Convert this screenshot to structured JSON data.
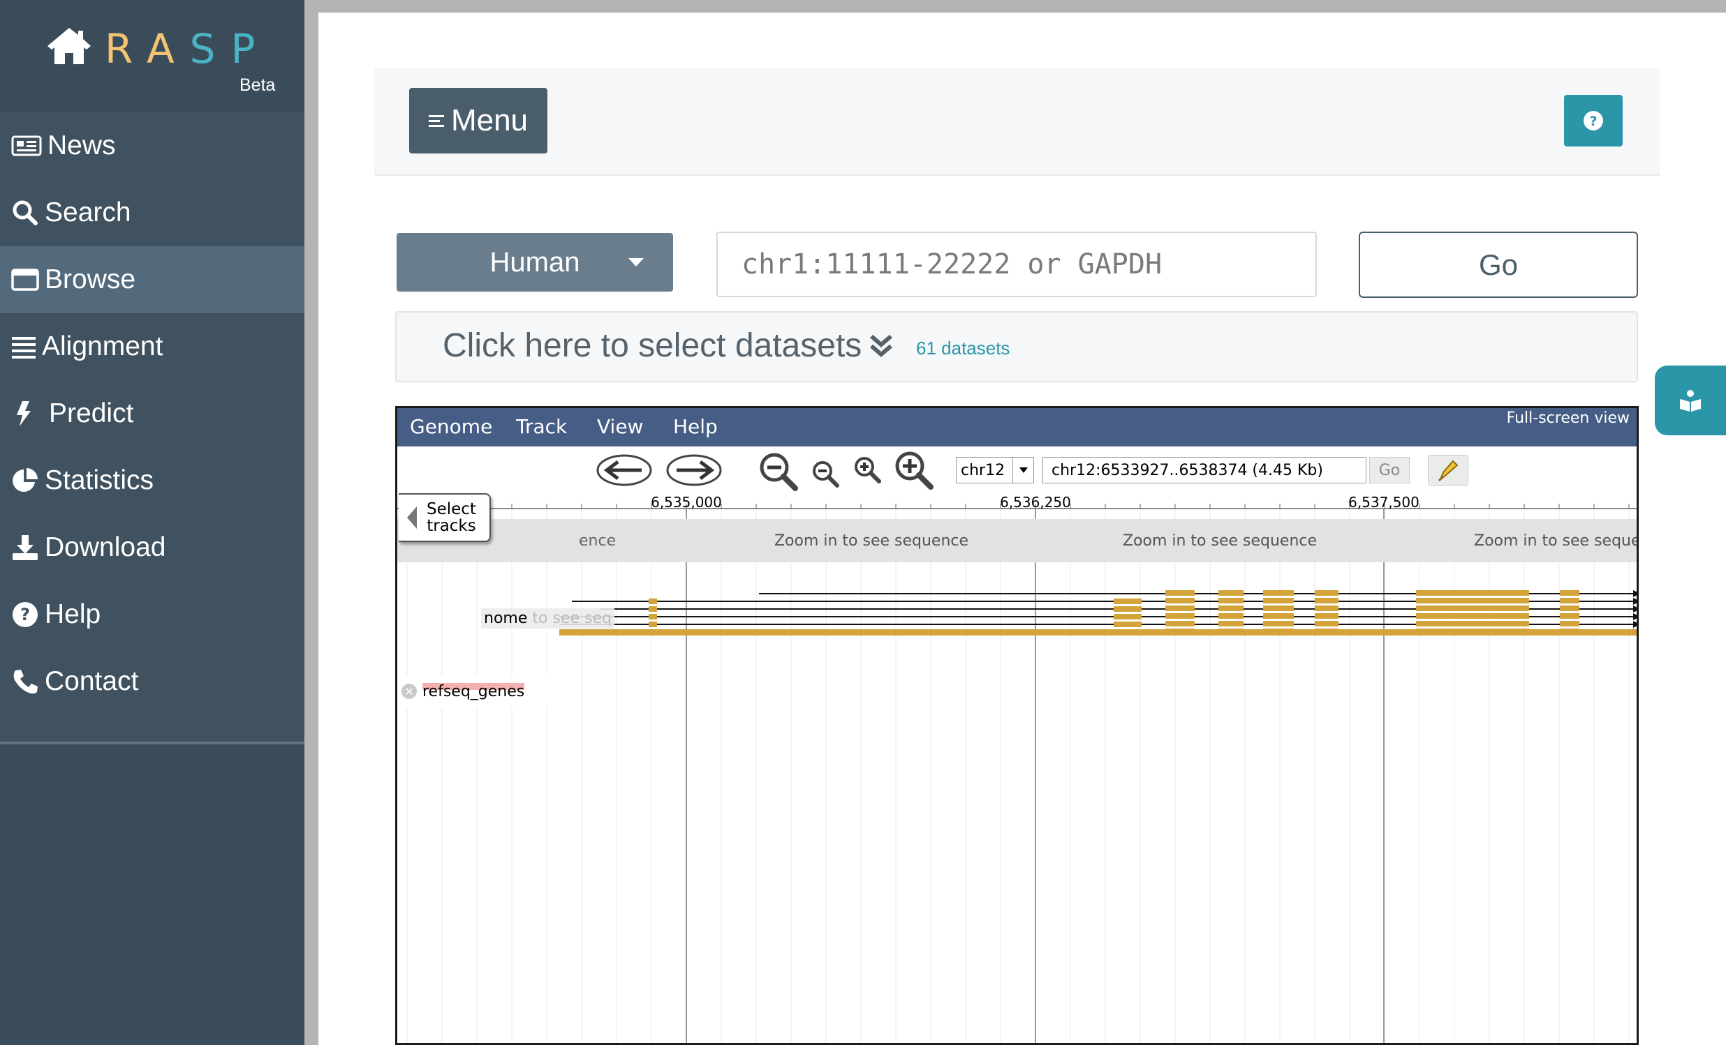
{
  "app": {
    "logo_letters": [
      "R",
      "A",
      "S",
      "P"
    ],
    "logo_colors": [
      "#f4c472",
      "#f4c472",
      "#4bb3c4",
      "#4bb3c4"
    ],
    "beta_label": "Beta"
  },
  "sidebar": {
    "items": [
      {
        "label": "News",
        "icon": "newspaper-icon",
        "active": false
      },
      {
        "label": "Search",
        "icon": "search-icon",
        "active": false
      },
      {
        "label": "Browse",
        "icon": "window-icon",
        "active": true
      },
      {
        "label": "Alignment",
        "icon": "align-justify-icon",
        "active": false
      },
      {
        "label": "Predict",
        "icon": "bolt-icon",
        "active": false
      },
      {
        "label": "Statistics",
        "icon": "pie-chart-icon",
        "active": false
      },
      {
        "label": "Download",
        "icon": "download-icon",
        "active": false
      },
      {
        "label": "Help",
        "icon": "question-circle-icon",
        "active": false
      },
      {
        "label": "Contact",
        "icon": "phone-icon",
        "active": false
      }
    ]
  },
  "header": {
    "menu_label": "Menu"
  },
  "controls": {
    "species": "Human",
    "search_placeholder": "chr1:11111-22222 or GAPDH",
    "go_label": "Go",
    "datasets_label": "Click here to select datasets",
    "datasets_count": "61 datasets"
  },
  "browser": {
    "menu": [
      "Genome",
      "Track",
      "View",
      "Help"
    ],
    "fullscreen_label": "Full-screen view",
    "chromosome": "chr12",
    "location": "chr12:6533927..6538374 (4.45 Kb)",
    "go_label": "Go",
    "select_tracks_line1": "Select",
    "select_tracks_line2": "tracks",
    "ruler_labels": [
      "6,535,000",
      "6,536,250",
      "6,537,500"
    ],
    "sequence_hint": "Zoom in to see sequence",
    "sequence_hint_partial": "Zoom in to see sequer",
    "sequence_hint_left": "ence",
    "sequence_hint_left_faint": "to see seq",
    "track_genome_label": "nome",
    "track_refseq_label": "refseq_genes",
    "feature_color": "#d4a43a",
    "header_color": "#465e86"
  }
}
